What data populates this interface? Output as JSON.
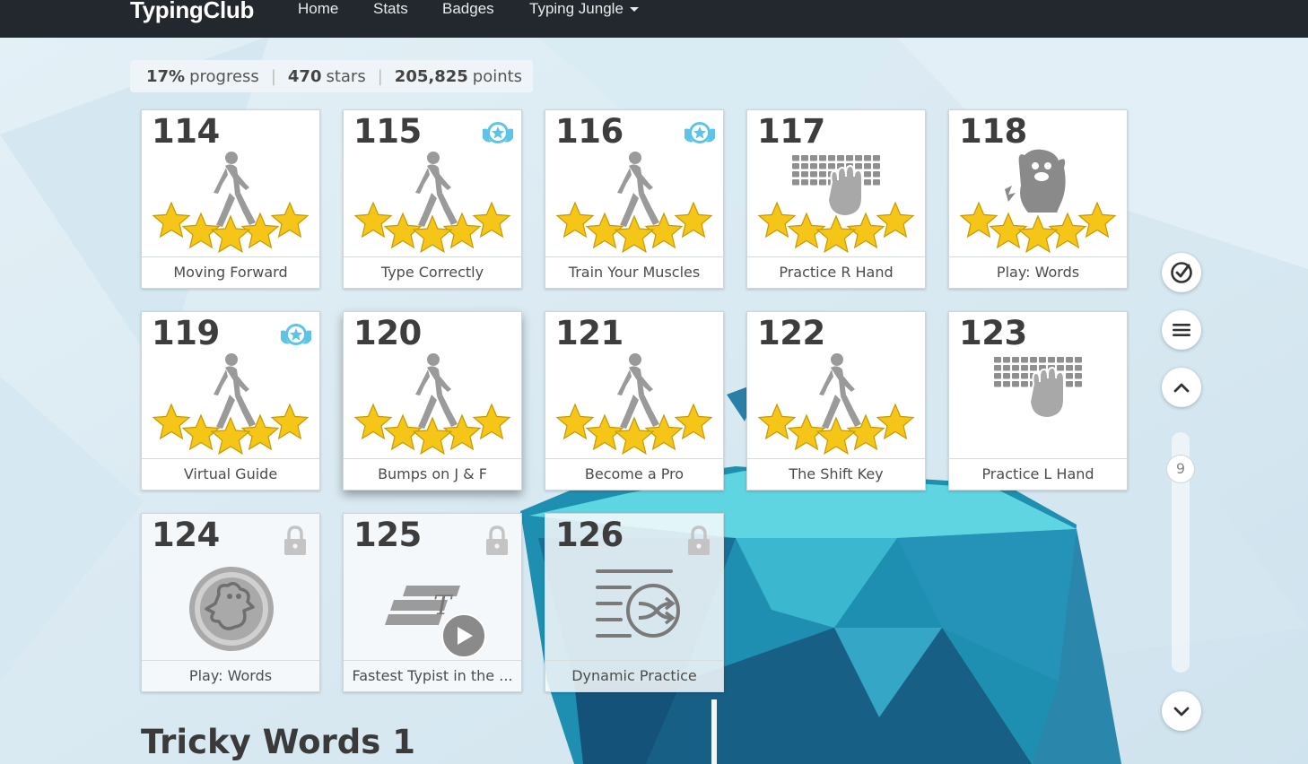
{
  "nav": {
    "brand": "TypingClub",
    "items": [
      "Home",
      "Stats",
      "Badges",
      "Typing Jungle"
    ]
  },
  "progress": {
    "percent": "17%",
    "percent_label": "progress",
    "stars": "470",
    "stars_label": "stars",
    "points": "205,825",
    "points_label": "points"
  },
  "lessons": [
    {
      "number": "114",
      "title": "Moving Forward",
      "art": "walking-person-icon",
      "stars": 5,
      "badge": false,
      "locked": false
    },
    {
      "number": "115",
      "title": "Type Correctly",
      "art": "walking-person-icon",
      "stars": 5,
      "badge": true,
      "locked": false
    },
    {
      "number": "116",
      "title": "Train Your Muscles",
      "art": "walking-person-icon",
      "stars": 5,
      "badge": true,
      "locked": false
    },
    {
      "number": "117",
      "title": "Practice R Hand",
      "art": "keyboard-hand-icon",
      "stars": 5,
      "badge": false,
      "locked": false
    },
    {
      "number": "118",
      "title": "Play: Words",
      "art": "game-monster-icon",
      "stars": 5,
      "badge": false,
      "locked": false
    },
    {
      "number": "119",
      "title": "Virtual Guide",
      "art": "walking-person-icon",
      "stars": 5,
      "badge": true,
      "locked": false
    },
    {
      "number": "120",
      "title": "Bumps on J & F",
      "art": "walking-person-icon",
      "stars": 5,
      "badge": false,
      "locked": false
    },
    {
      "number": "121",
      "title": "Become a Pro",
      "art": "walking-person-icon",
      "stars": 5,
      "badge": false,
      "locked": false
    },
    {
      "number": "122",
      "title": "The Shift Key",
      "art": "walking-person-icon",
      "stars": 5,
      "badge": false,
      "locked": false
    },
    {
      "number": "123",
      "title": "Practice L Hand",
      "art": "keyboard-hand-icon",
      "stars": 0,
      "badge": false,
      "locked": false
    },
    {
      "number": "124",
      "title": "Play: Words",
      "art": "game-circle-icon",
      "stars": 0,
      "badge": false,
      "locked": true
    },
    {
      "number": "125",
      "title": "Fastest Typist in the ...",
      "art": "speed-type-video-icon",
      "stars": 0,
      "badge": false,
      "locked": true
    },
    {
      "number": "126",
      "title": "Dynamic Practice",
      "art": "shuffle-lines-icon",
      "stars": 0,
      "badge": false,
      "locked": true
    }
  ],
  "side": {
    "scroll_position": "9"
  },
  "section": {
    "title": "Tricky Words 1"
  },
  "colors": {
    "navbar": "#22282d",
    "star": "#f5c518",
    "badge": "#5ec3e6"
  }
}
